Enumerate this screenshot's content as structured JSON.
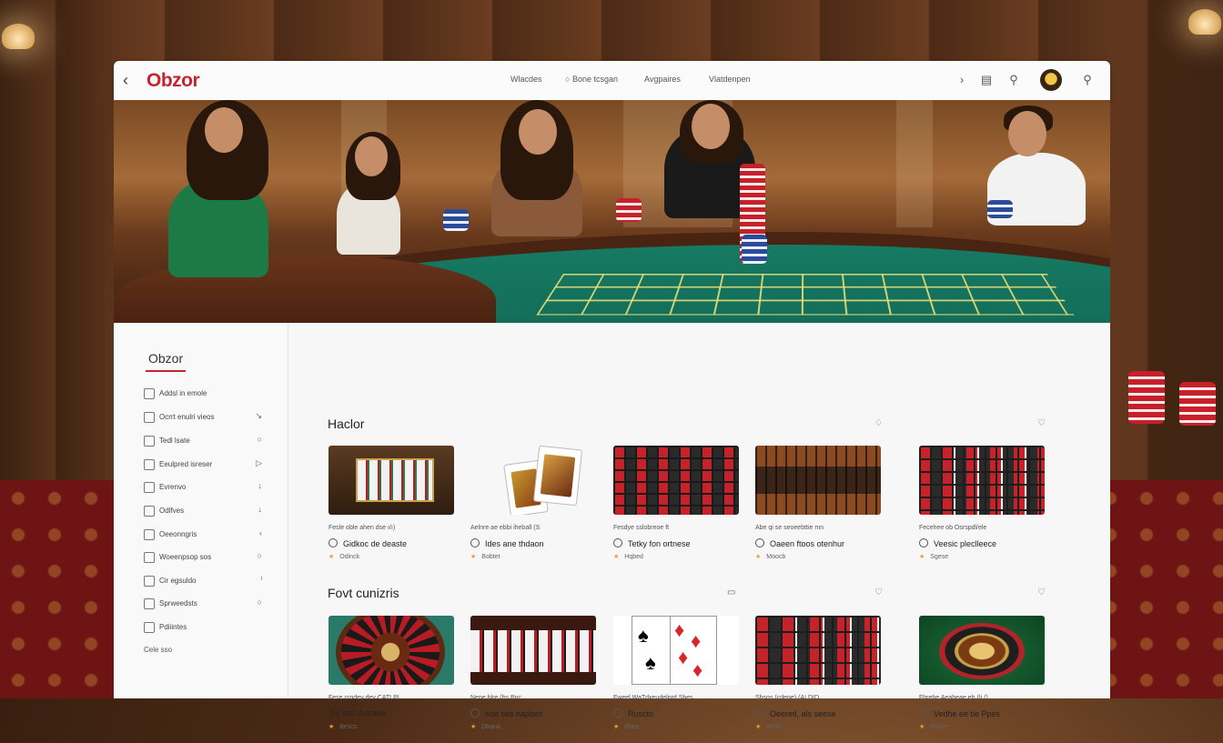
{
  "app": {
    "logo": "Obzor",
    "nav": [
      "Wlacdes",
      "Bone tcsgan",
      "Avgpaires",
      "Vlatdenpen"
    ]
  },
  "sidebar": {
    "title": "Obzor",
    "items": [
      {
        "label": "Addsl in emole",
        "trail": ""
      },
      {
        "label": "Ocrrt enulri vieos",
        "trail": "↘"
      },
      {
        "label": "Tedl lsate",
        "trail": "○"
      },
      {
        "label": "Eeulpred isreser",
        "trail": "▷"
      },
      {
        "label": "Evrenvo",
        "trail": "↓"
      },
      {
        "label": "Odlfves",
        "trail": "↓"
      },
      {
        "label": "Oeeonngris",
        "trail": "‹"
      },
      {
        "label": "Woeenpsop sos",
        "trail": "○"
      },
      {
        "label": "Cir egsuldo",
        "trail": "ˡ"
      },
      {
        "label": "Sprweedsts",
        "trail": "○"
      },
      {
        "label": "Pdiiintes",
        "trail": ""
      }
    ],
    "footer": "Cele sso"
  },
  "sections": [
    {
      "title": "Haclor",
      "cards": [
        {
          "meta1": "Fesle oble ahen dse ı/ı)",
          "title": "Gidkoc de deaste",
          "meta2": "Odinck"
        },
        {
          "meta1": "Aelnre ae ebbi iheball (S",
          "title": "Ides ane thdaon",
          "meta2": "Bobtet"
        },
        {
          "meta1": "Fesdye sslobreoe ft",
          "title": "Tetky fon ortnese",
          "meta2": "Hqbed"
        },
        {
          "meta1": "Abe qi se seoeebttie mn",
          "title": "Oaeen ftoos otenhur",
          "meta2": "Moocb"
        },
        {
          "meta1": "Fecehee ob Osrspdl/ele",
          "title": "Veesic pleclleece",
          "meta2": "Sgese"
        }
      ]
    },
    {
      "title": "Fovt cunizris",
      "cards": [
        {
          "meta1": "Fese crodey dev CATLPI",
          "title": "Try cec dvicaue",
          "meta2": "Bescs"
        },
        {
          "meta1": "Nene blre (bs Bnc",
          "title": "eoe ses hapbes",
          "meta2": "Dbqua"
        },
        {
          "meta1": "Fweel WaTdxeudelprd Sbes",
          "title": "Ruscto",
          "meta2": "Pbeo"
        },
        {
          "meta1": "Sbsos (cdeqe) (ALDID",
          "title": "Oeeretl, als seese",
          "meta2": "Wrab"
        },
        {
          "meta1": "Fbrehe Aeabeae eh (Ii ()",
          "title": "Vedhe ee tie Ppes",
          "meta2": "Pluiter"
        }
      ]
    }
  ],
  "colors": {
    "accent": "#c3262e",
    "star": "#e2a21d"
  }
}
